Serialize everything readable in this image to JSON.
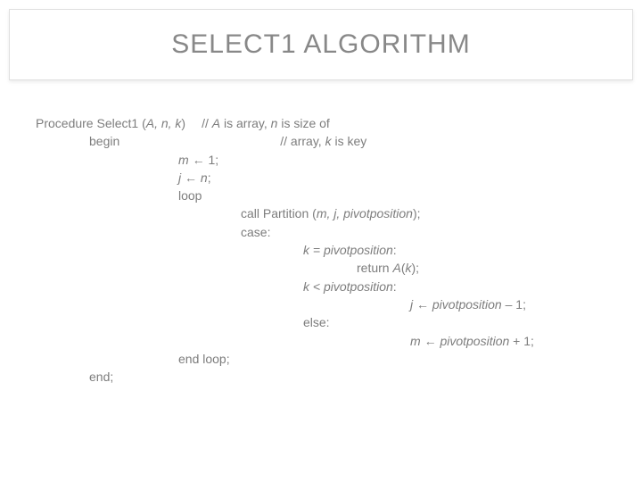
{
  "title": "SELECT1 ALGORITHM",
  "proc": {
    "line1_a": "Procedure Select1 (",
    "line1_b": "A, n, k",
    "line1_c": ")",
    "line1_d": "// ",
    "line1_e": "A",
    "line1_f": " is array, ",
    "line1_g": "n",
    "line1_h": " is size of",
    "line2_a": "begin",
    "line2_b": "// array, ",
    "line2_c": "k",
    "line2_d": " is key",
    "m1_a": "m ",
    "arrow": "←",
    "m1_b": " 1;",
    "jn_a": "j ",
    "jn_b": " n",
    "jn_c": ";",
    "loop": "loop",
    "call_a": "call Partition (",
    "call_b": "m, j, pivotposition",
    "call_c": ");",
    "case": "case:",
    "c1_a": "k = pivotposition",
    "c1_b": ":",
    "ret_a": "return ",
    "ret_b": "A",
    "ret_c": "(",
    "ret_d": "k",
    "ret_e": ");",
    "c2_a": "k < pivotposition",
    "c2_b": ":",
    "jp_a": "j ",
    "jp_b": " pivotposition ",
    "jp_c": "– 1;",
    "else": "else:",
    "mp_a": "m ",
    "mp_b": " pivotposition ",
    "mp_c": "+ 1;",
    "endloop": "end loop;",
    "end": "end;"
  }
}
